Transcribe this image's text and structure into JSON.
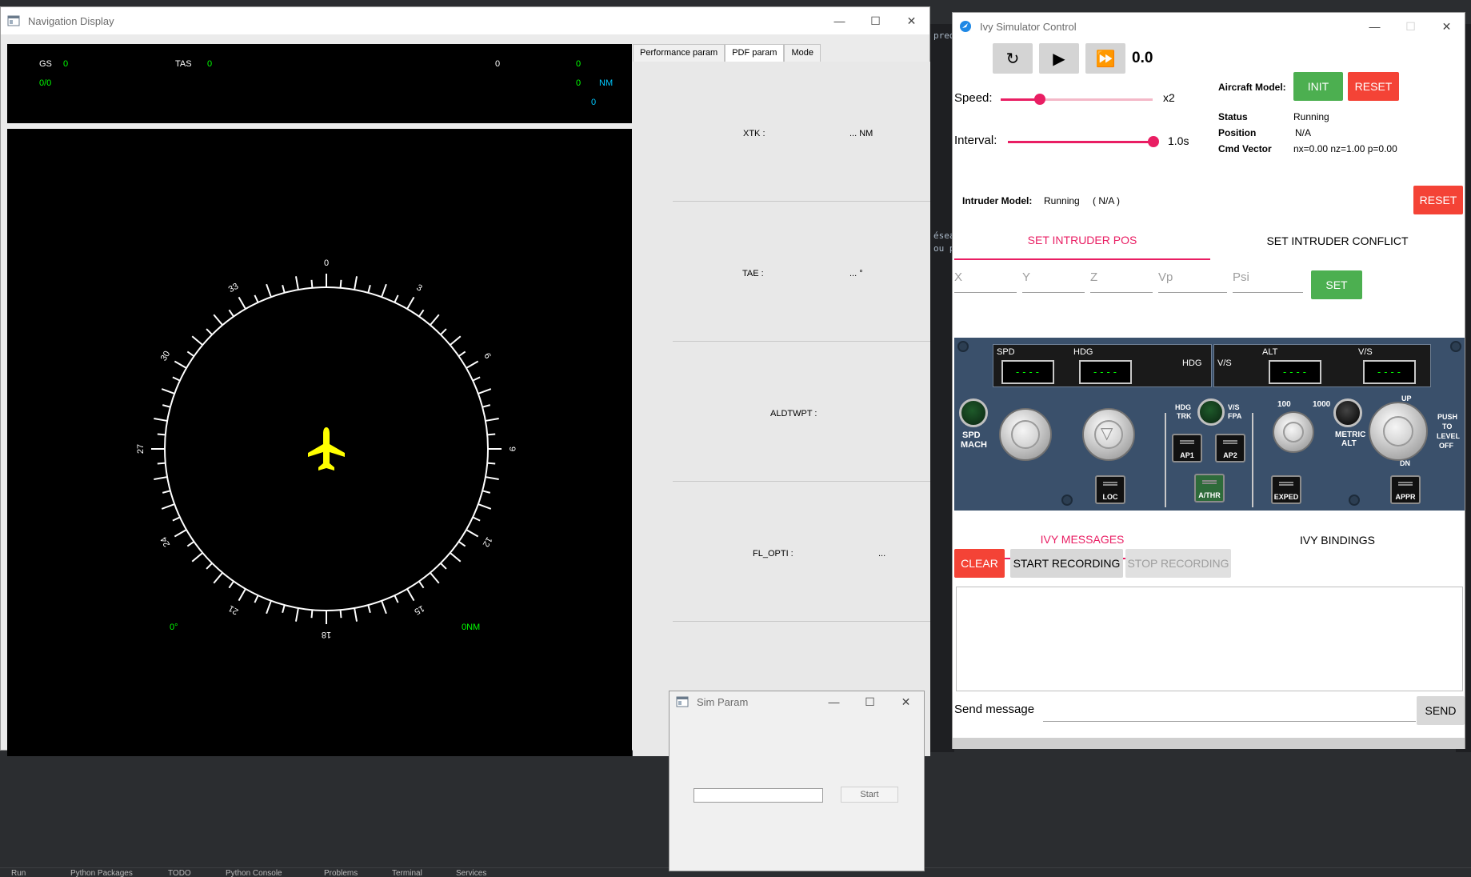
{
  "ide": {
    "editor_fragments": [
      "pred",
      "ésea",
      "ou p"
    ],
    "bottom_tabs": [
      "Run",
      "Python Packages",
      "TODO",
      "Python Console",
      "Problems",
      "Terminal",
      "Services"
    ]
  },
  "nav_display": {
    "title": "Navigation Display",
    "top_panel": {
      "gs_label": "GS",
      "gs_value": "0",
      "tas_label": "TAS",
      "tas_value": "0",
      "wind": "0/0",
      "right_value_1": "0",
      "right_value_2": "0",
      "right_value_3": "0",
      "dist_unit": "NM",
      "right_value_4": "0"
    },
    "compass": {
      "labels": [
        "0",
        "3",
        "6",
        "9",
        "12",
        "15",
        "18",
        "21",
        "24",
        "27",
        "30",
        "33"
      ],
      "bottom_left": "0°",
      "bottom_right": "0NM"
    },
    "tabs": [
      "Performance param",
      "PDF param",
      "Mode"
    ],
    "active_tab": 1,
    "params": [
      {
        "label": "XTK :",
        "value": "... NM"
      },
      {
        "label": "TAE :",
        "value": "... °"
      },
      {
        "label": "ALDTWPT :",
        "value": ""
      },
      {
        "label": "FL_OPTI :",
        "value": "..."
      }
    ]
  },
  "ivy": {
    "title": "Ivy Simulator Control",
    "sim_time": "0.0",
    "speed_label": "Speed:",
    "speed_value": "x2",
    "speed_level": 0.26,
    "interval_label": "Interval:",
    "interval_value": "1.0s",
    "interval_level": 1.0,
    "aircraft_model_label": "Aircraft Model:",
    "init_button": "INIT",
    "reset_button": "RESET",
    "status_label": "Status",
    "status_value": "Running",
    "position_label": "Position",
    "position_value": "N/A",
    "cmd_vector_label": "Cmd Vector",
    "cmd_vector_value": "nx=0.00 nz=1.00 p=0.00",
    "intruder_model_label": "Intruder Model:",
    "intruder_status": "Running",
    "intruder_position": "( N/A )",
    "intruder_reset_button": "RESET",
    "tabs": [
      "SET INTRUDER POS",
      "SET INTRUDER CONFLICT"
    ],
    "fields": [
      "X",
      "Y",
      "Z",
      "Vp",
      "Psi"
    ],
    "set_button": "SET",
    "fcu": {
      "spd": "SPD",
      "hdg": "HDG",
      "hdg_right": "HDG",
      "vs_left": "V/S",
      "alt": "ALT",
      "vs": "V/S",
      "display_dashes": "----",
      "spd_mach": [
        "SPD",
        "MACH"
      ],
      "hdg_trk": [
        "HDG",
        "TRK"
      ],
      "vs_fpa": [
        "V/S",
        "FPA"
      ],
      "alt_100": "100",
      "alt_1000": "1000",
      "metric_alt": [
        "METRIC",
        "ALT"
      ],
      "up": "UP",
      "dn": "DN",
      "push_to_level_off": [
        "PUSH",
        "TO",
        "LEVEL",
        "OFF"
      ],
      "loc": "LOC",
      "ap1": "AP1",
      "ap2": "AP2",
      "athr": "A/THR",
      "exped": "EXPED",
      "appr": "APPR"
    },
    "message_tabs": [
      "IVY MESSAGES",
      "IVY BINDINGS"
    ],
    "clear_button": "CLEAR",
    "start_recording_button": "START RECORDING",
    "stop_recording_button": "STOP RECORDING",
    "send_message_label": "Send message",
    "send_button": "SEND"
  },
  "sim_param": {
    "title": "Sim Param",
    "start_button": "Start"
  }
}
